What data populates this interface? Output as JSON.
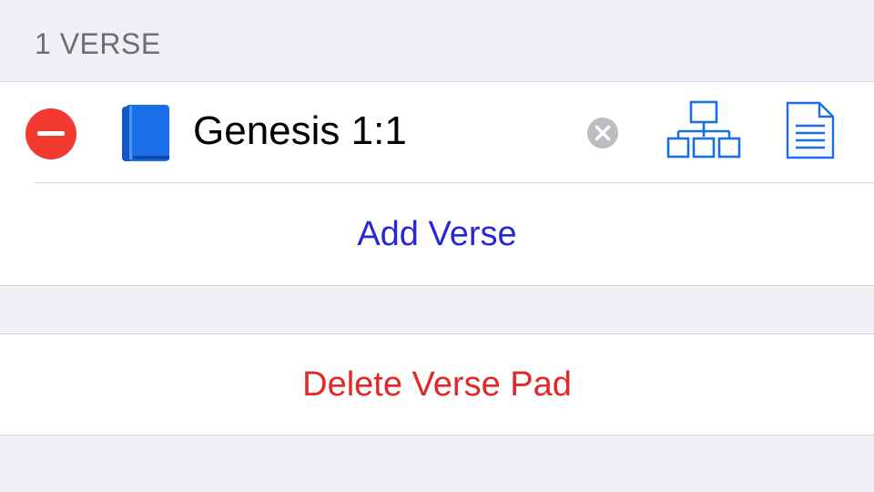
{
  "section": {
    "header_label": "1 VERSE"
  },
  "verses": [
    {
      "reference": "Genesis 1:1",
      "icons": {
        "remove": "minus-circle-icon",
        "book": "book-icon",
        "clear": "clear-circle-x-icon",
        "tree": "hierarchy-tree-icon",
        "document": "document-icon"
      }
    }
  ],
  "actions": {
    "add_verse_label": "Add Verse",
    "delete_pad_label": "Delete Verse Pad"
  },
  "colors": {
    "background": "#efeff4",
    "card": "#ffffff",
    "accent_blue": "#1a6fe8",
    "link_blue": "#2628d8",
    "destructive_red": "#e32626",
    "delete_circle_red": "#f23a30",
    "clear_gray": "#bcbcc1",
    "section_text_gray": "#6d6d72"
  }
}
